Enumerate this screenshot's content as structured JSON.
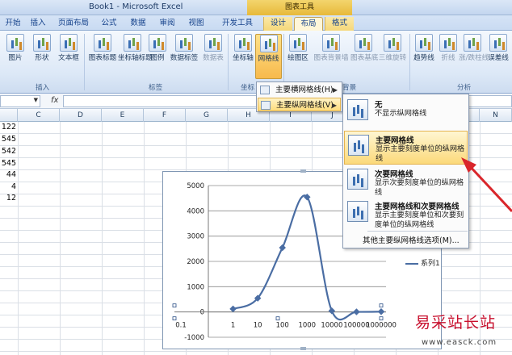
{
  "window": {
    "title": "Book1 - Microsoft Excel",
    "context_title": "图表工具"
  },
  "tabs": [
    "开始",
    "插入",
    "页面布局",
    "公式",
    "数据",
    "审阅",
    "视图",
    "开发工具",
    "设计",
    "布局",
    "格式"
  ],
  "active_tab": "布局",
  "ribbon": {
    "buttons": [
      {
        "label": "图片"
      },
      {
        "label": "形状"
      },
      {
        "label": "文本框"
      },
      {
        "label": "图表标题"
      },
      {
        "label": "坐标轴标题"
      },
      {
        "label": "图例"
      },
      {
        "label": "数据标签"
      },
      {
        "label": "数据表"
      },
      {
        "label": "坐标轴"
      },
      {
        "label": "网格线"
      },
      {
        "label": "绘图区"
      },
      {
        "label": "图表背景墙"
      },
      {
        "label": "图表基底"
      },
      {
        "label": "三维旋转"
      },
      {
        "label": "趋势线"
      },
      {
        "label": "折线"
      },
      {
        "label": "涨/跌柱线"
      },
      {
        "label": "误差线"
      }
    ],
    "groups": [
      "插入",
      "标签",
      "坐标",
      "背景",
      "分析"
    ]
  },
  "formula_bar": {
    "fx": "fx"
  },
  "columns": [
    "C",
    "D",
    "E",
    "F",
    "G",
    "H",
    "I",
    "J",
    "K",
    "L",
    "M",
    "N"
  ],
  "cell_values": [
    "122",
    "545",
    "542",
    "545",
    "44",
    "4",
    "12"
  ],
  "chart_data": {
    "type": "line",
    "x_ticks": [
      "0.1",
      "1",
      "10",
      "100",
      "1000",
      "10000",
      "100000",
      "1000000"
    ],
    "x": [
      1,
      10,
      100,
      1000,
      10000,
      100000,
      1000000
    ],
    "series": [
      {
        "name": "系列1",
        "values": [
          122,
          545,
          2542,
          4545,
          44,
          4,
          12
        ]
      }
    ],
    "y_ticks": [
      "-1000",
      "0",
      "1000",
      "2000",
      "3000",
      "4000",
      "5000"
    ],
    "ylim": [
      -1000,
      5000
    ],
    "x_scale": "log",
    "grid": "horizontal",
    "legend_position": "right"
  },
  "menu1": {
    "items": [
      {
        "label": "主要横网格线(H)"
      },
      {
        "label": "主要纵网格线(V)"
      }
    ]
  },
  "menu2": {
    "options": [
      {
        "title": "无",
        "desc": "不显示纵网格线"
      },
      {
        "title": "主要网格线",
        "desc": "显示主要刻度单位的纵网格线"
      },
      {
        "title": "次要网格线",
        "desc": "显示次要刻度单位的纵网格线"
      },
      {
        "title": "主要网格线和次要网格线",
        "desc": "显示主要刻度单位和次要刻度单位的纵网格线"
      }
    ],
    "more": "其他主要纵网格线选项(M)..."
  },
  "watermark": {
    "name": "易采站长站",
    "url": "www.easck.com"
  },
  "colors": {
    "series": "#4a6da3",
    "arrow": "#d9262b",
    "highlight": "#fbd97a"
  }
}
